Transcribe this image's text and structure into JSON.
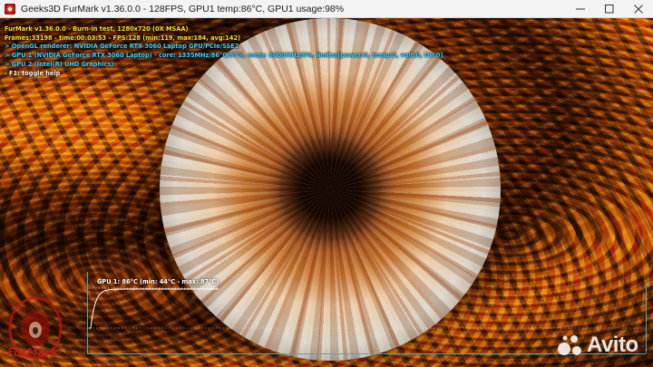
{
  "window": {
    "title": "Geeks3D FurMark v1.36.0.0 - 128FPS, GPU1 temp:86°C, GPU1 usage:98%",
    "app_icon": "furmark-icon",
    "controls": {
      "minimize": "minimize-icon",
      "maximize": "maximize-icon",
      "close": "close-icon"
    }
  },
  "osd": {
    "lines": [
      {
        "text": "FurMark v1.36.0.0 - Burn-in test, 1280x720 (0X MSAA)",
        "color": "#ffe028"
      },
      {
        "text": "Frames:33198 - time:00:03:53 - FPS:128 (min:119, max:184, avg:142)",
        "color": "#ffe028"
      },
      {
        "text": "> OpenGL renderer: NVIDIA GeForce RTX 3060 Laptop GPU/PCIe/SSE2",
        "color": "#38d2ff"
      },
      {
        "text": "> GPU 1 (NVIDIA GeForce RTX 3060 Laptop) - core: 1335MHz/86°C/97%, mem: 6000MHz/8%, limits:[power:0, temp:0, volt:0, OV:0]",
        "color": "#38d2ff"
      },
      {
        "text": "> GPU 2 (Intel(R) UHD Graphics)",
        "color": "#38d2ff"
      },
      {
        "text": "- F1: toggle help",
        "color": "#ffffff"
      }
    ]
  },
  "graph": {
    "label": "GPU 1: 86°C (min: 44°C - max: 87°C)",
    "min_temp": 44,
    "max_temp": 87,
    "current_temp": 86,
    "line_color": "#ffffff",
    "axis_color": "#3ab0c8"
  },
  "logo": {
    "text": "FurMark",
    "color": "#c21e14"
  },
  "watermark": {
    "text": "Avito",
    "icon": "avito-dots-icon"
  }
}
